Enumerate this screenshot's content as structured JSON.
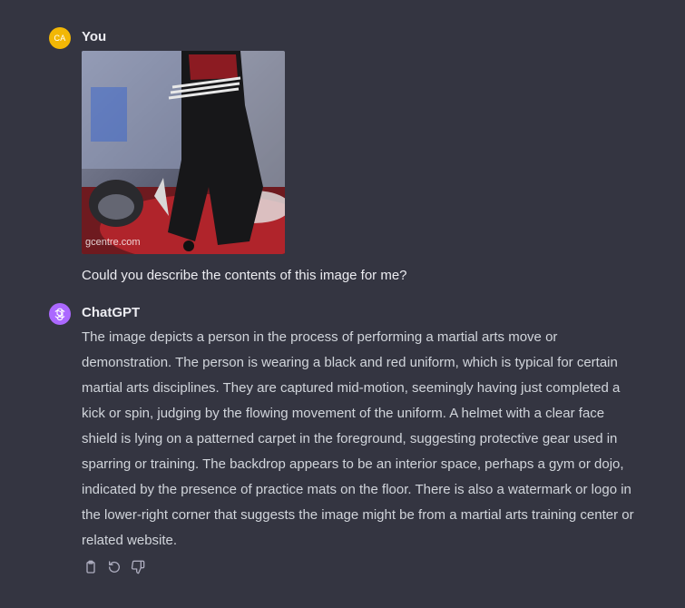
{
  "user_message": {
    "avatar_initials": "CA",
    "author": "You",
    "image_watermark": "gcentre.com",
    "text": "Could you describe the contents of this image for me?"
  },
  "assistant_message": {
    "author": "ChatGPT",
    "text": "The image depicts a person in the process of performing a martial arts move or demonstration. The person is wearing a black and red uniform, which is typical for certain martial arts disciplines. They are captured mid-motion, seemingly having just completed a kick or spin, judging by the flowing movement of the uniform. A helmet with a clear face shield is lying on a patterned carpet in the foreground, suggesting protective gear used in sparring or training. The backdrop appears to be an interior space, perhaps a gym or dojo, indicated by the presence of practice mats on the floor. There is also a watermark or logo in the lower-right corner that suggests the image might be from a martial arts training center or related website."
  },
  "actions": [
    {
      "icon": "clipboard-icon"
    },
    {
      "icon": "regenerate-icon"
    },
    {
      "icon": "thumbs-down-icon"
    }
  ],
  "colors": {
    "background": "#343541",
    "user_avatar": "#f2b705",
    "assistant_avatar": "#ab68ff",
    "body_text": "#d1d5db"
  }
}
